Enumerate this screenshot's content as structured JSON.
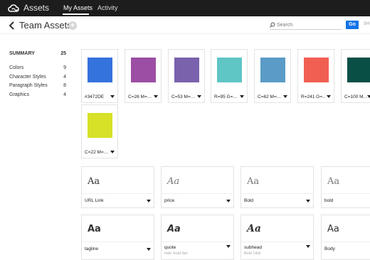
{
  "topbar": {
    "app_title": "Assets",
    "tabs": [
      {
        "label": "My Assets",
        "active": true
      },
      {
        "label": "Activity",
        "active": false
      }
    ]
  },
  "header": {
    "title": "Team Assets",
    "add_label": "+",
    "search_placeholder": "Search",
    "go_label": "Go",
    "truncated_text": "SH"
  },
  "sidebar": {
    "summary": {
      "label": "SUMMARY",
      "count": "25"
    },
    "items": [
      {
        "label": "Colors",
        "count": "9"
      },
      {
        "label": "Character Styles",
        "count": "4"
      },
      {
        "label": "Paragraph Styles",
        "count": "8"
      },
      {
        "label": "Graphics",
        "count": "4"
      }
    ]
  },
  "colors": [
    {
      "label": "#3472DE",
      "hex": "#3472de"
    },
    {
      "label": "C=26 M=…",
      "hex": "#9b4ea3"
    },
    {
      "label": "C=53 M=…",
      "hex": "#7a62ad"
    },
    {
      "label": "R=95 G=…",
      "hex": "#5fc5c5"
    },
    {
      "label": "C=62 M=…",
      "hex": "#5a9bc7"
    },
    {
      "label": "R=241 G=…",
      "hex": "#f15f52"
    },
    {
      "label": "C=100 M…",
      "hex": "#0a4f46"
    },
    {
      "label": "C=22 M=…",
      "hex": "#d6e127"
    }
  ],
  "character_styles": [
    {
      "sample": "Aa",
      "label": "URL Link"
    },
    {
      "sample": "Aa",
      "label": "price"
    },
    {
      "sample": "Aa",
      "label": "Bold"
    },
    {
      "sample": "Aa",
      "label": "bold"
    }
  ],
  "paragraph_styles": [
    {
      "sample": "Aa",
      "label": "tagline",
      "meta": ""
    },
    {
      "sample": "Aa",
      "label": "quote",
      "meta": "italic  bold  9pt"
    },
    {
      "sample": "Aa",
      "label": "subhead",
      "meta": "Bold  14pt"
    },
    {
      "sample": "Aa",
      "label": "Body",
      "meta": ""
    }
  ]
}
